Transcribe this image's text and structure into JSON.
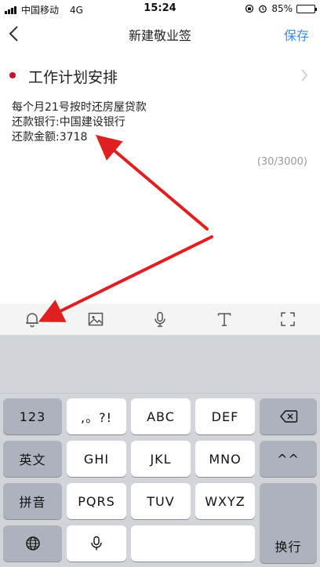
{
  "status_bar": {
    "carrier": "中国移动",
    "network": "4G",
    "time": "15:24",
    "battery_percent": "85%",
    "battery_level": 0.85
  },
  "nav": {
    "back_icon": "chevron-left-icon",
    "title": "新建敬业签",
    "save_label": "保存"
  },
  "note": {
    "title": "工作计划安排",
    "title_color": "#c8102e",
    "lines": [
      "每个月21号按时还房屋贷款",
      "还款银行:中国建设银行",
      "还款金额:3718"
    ],
    "char_count": "(30/3000)"
  },
  "toolbar": {
    "icons": [
      "bell-icon",
      "image-icon",
      "microphone-icon",
      "text-format-icon",
      "fullscreen-icon"
    ]
  },
  "keyboard": {
    "row1": [
      "123",
      ",。?!",
      "ABC",
      "DEF"
    ],
    "row2": [
      "英文",
      "GHI",
      "JKL",
      "MNO",
      "^^"
    ],
    "row3": [
      "拼音",
      "PQRS",
      "TUV",
      "WXYZ"
    ],
    "enter_label": "换行",
    "icons": [
      "backspace-icon",
      "globe-icon",
      "microphone-icon"
    ]
  },
  "accent_color": "#3a8ee6",
  "annotation_color": "#e02020"
}
